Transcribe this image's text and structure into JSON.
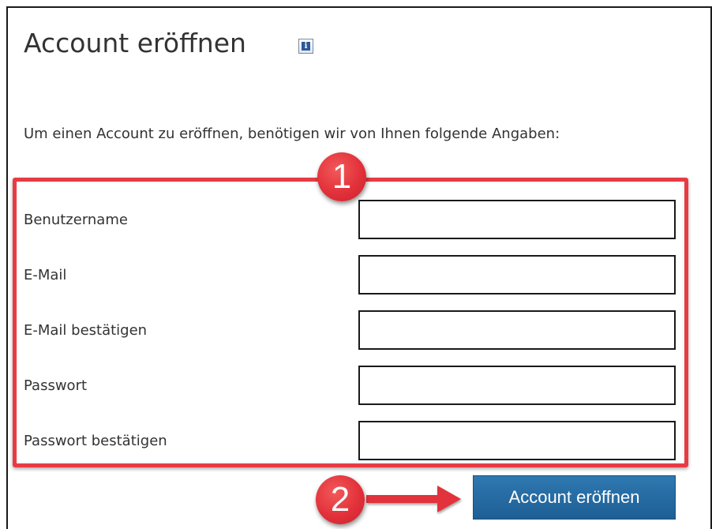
{
  "header": {
    "title": "Account eröffnen",
    "info_icon": "info-icon"
  },
  "intro_text": "Um einen Account zu eröffnen, benötigen wir von Ihnen folgende Angaben:",
  "annotations": {
    "badge_1": "1",
    "badge_2": "2",
    "highlight_color": "#e83b44"
  },
  "form": {
    "fields": [
      {
        "label": "Benutzername",
        "value": ""
      },
      {
        "label": "E-Mail",
        "value": ""
      },
      {
        "label": "E-Mail bestätigen",
        "value": ""
      },
      {
        "label": "Passwort",
        "value": ""
      },
      {
        "label": "Passwort bestätigen",
        "value": ""
      }
    ],
    "submit_label": "Account eröffnen",
    "submit_color": "#1d5f95"
  }
}
